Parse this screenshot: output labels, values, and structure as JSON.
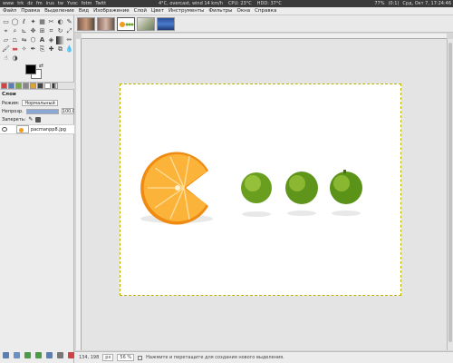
{
  "panel": {
    "left_items": [
      "www",
      "trk",
      "dz",
      "fm",
      "irus",
      "tw",
      "Yvoc",
      "fotm",
      "Twitt"
    ],
    "weather": "4°C, overcast, wind 14 km/h",
    "cpu": "CPU: 23°C",
    "hdd": "HDD: 37°C",
    "battery": "77%",
    "indicator": "(0:1)",
    "datetime": "Срд, Окт 7, 17:24:46"
  },
  "menu": [
    "Файл",
    "Правка",
    "Выделение",
    "Вид",
    "Изображение",
    "Слой",
    "Цвет",
    "Инструменты",
    "Фильтры",
    "Окна",
    "Справка"
  ],
  "colors": {
    "foreground": "#000000",
    "background": "#ffffff",
    "accent": "#5b7fb5"
  },
  "layers": {
    "title": "Слои",
    "mode_label": "Режим:",
    "mode_value": "Нормальный",
    "opacity_label": "Непрозр.",
    "opacity_value": "100,0",
    "lock_label": "Запереть:",
    "layer_name": "pacmanpp8.jpg"
  },
  "status": {
    "coords": "134, 198",
    "unit": "px",
    "zoom": "56 %",
    "message": "Нажмите и перетащите для создания нового выделения."
  },
  "icons": {
    "tools": [
      "rect-select-icon",
      "ellipse-select-icon",
      "lasso-icon",
      "fuzzy-select-icon",
      "color-select-icon",
      "scissors-icon",
      "fg-select-icon",
      "paths-icon",
      "color-picker-icon",
      "zoom-icon",
      "measure-icon",
      "move-icon",
      "align-icon",
      "crop-icon",
      "rotate-icon",
      "scale-icon",
      "shear-icon",
      "perspective-icon",
      "flip-icon",
      "cage-icon",
      "text-icon",
      "bucket-fill-icon",
      "blend-icon",
      "pencil-icon",
      "paintbrush-icon",
      "eraser-icon",
      "airbrush-icon",
      "ink-icon",
      "clone-icon",
      "heal-icon",
      "perspective-clone-icon",
      "blur-icon",
      "smudge-icon",
      "dodge-burn-icon"
    ]
  }
}
